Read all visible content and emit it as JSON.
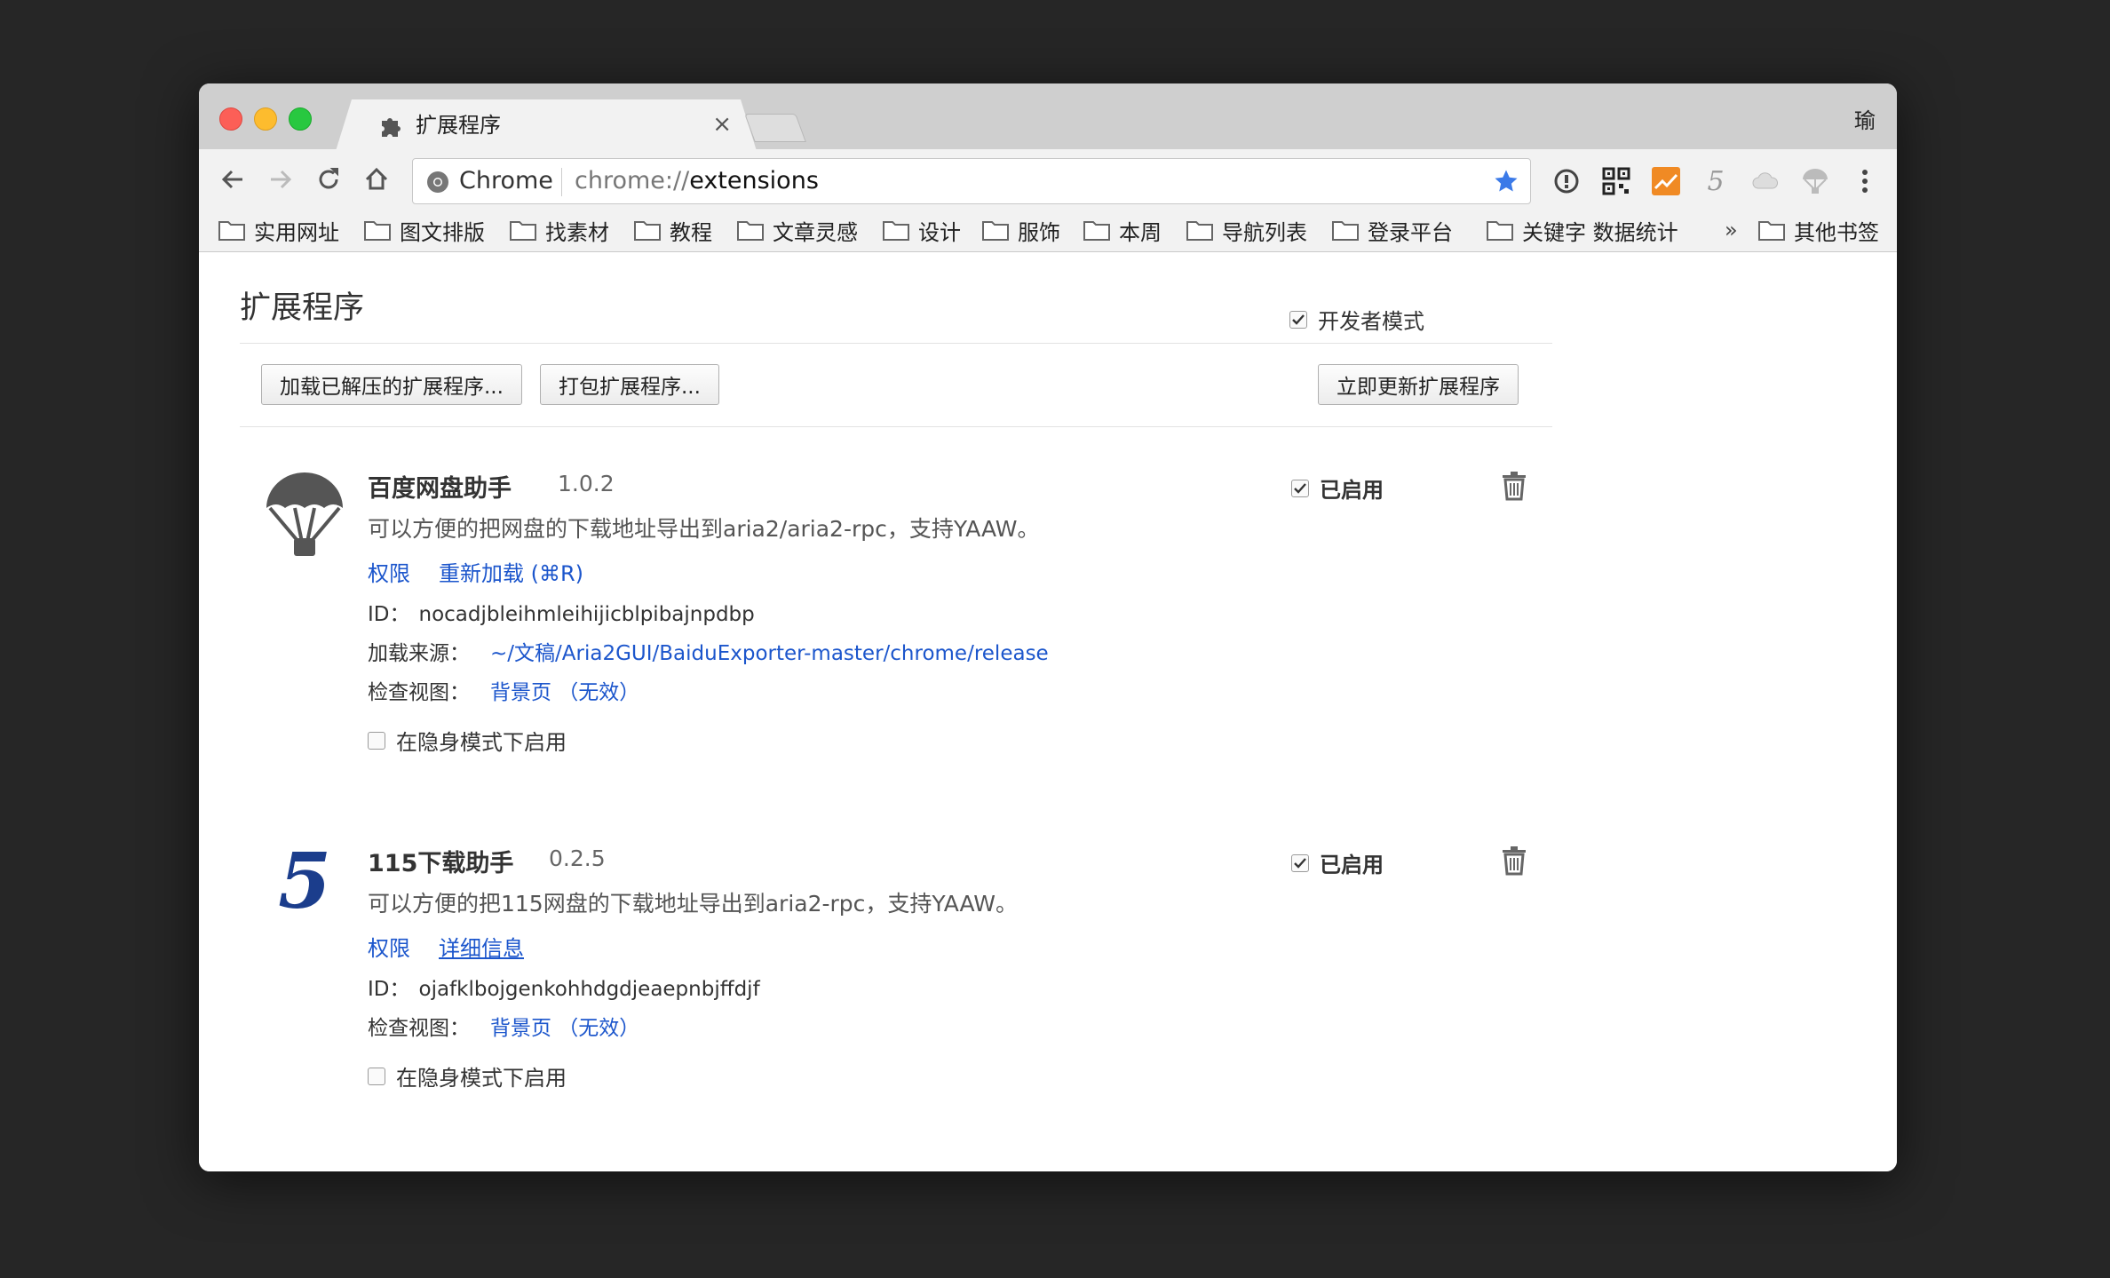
{
  "window": {
    "tab_title": "扩展程序",
    "tab_close": "×",
    "profile_name": "瑜"
  },
  "omnibox": {
    "chip": "Chrome",
    "scheme": "chrome://",
    "host": "extensions"
  },
  "bookmarks": [
    {
      "label": "实用网址"
    },
    {
      "label": "图文排版"
    },
    {
      "label": "找素材"
    },
    {
      "label": "教程"
    },
    {
      "label": "文章灵感"
    },
    {
      "label": "设计"
    },
    {
      "label": "服饰"
    },
    {
      "label": "本周"
    },
    {
      "label": "导航列表"
    },
    {
      "label": "登录平台"
    },
    {
      "label": "关键字 数据统计"
    }
  ],
  "bookmarks_more": "»",
  "bookmarks_other": "其他书签",
  "page": {
    "title": "扩展程序",
    "dev_mode_label": "开发者模式",
    "dev_mode_checked": true,
    "buttons": {
      "load_unpacked": "加载已解压的扩展程序...",
      "pack": "打包扩展程序...",
      "update": "立即更新扩展程序"
    }
  },
  "extensions": [
    {
      "name": "百度网盘助手",
      "version": "1.0.2",
      "description": "可以方便的把网盘的下载地址导出到aria2/aria2-rpc，支持YAAW。",
      "link_permissions": "权限",
      "link_reload": "重新加载 (⌘R)",
      "id_label": "ID：",
      "id_value": "nocadjbleihmleihijicblpibajnpdbp",
      "source_label": "加载来源：",
      "source_value": "~/文稿/Aria2GUI/BaiduExporter-master/chrome/release",
      "views_label": "检查视图：",
      "views_value": "背景页 （无效）",
      "incognito_label": "在隐身模式下启用",
      "enabled_label": "已启用"
    },
    {
      "name": "115下载助手",
      "version": "0.2.5",
      "logo_text": "5",
      "description": "可以方便的把115网盘的下载地址导出到aria2-rpc，支持YAAW。",
      "link_permissions": "权限",
      "link_details": "详细信息",
      "id_label": "ID：",
      "id_value": "ojafklbojgenkohhdgdjeaepnbjffdjf",
      "views_label": "检查视图：",
      "views_value": "背景页 （无效）",
      "incognito_label": "在隐身模式下启用",
      "enabled_label": "已启用"
    }
  ],
  "toolbar_ext_icons": [
    {
      "icon": "info-circle-icon"
    },
    {
      "icon": "qr-code-icon"
    },
    {
      "icon": "chart-orange-icon",
      "color": "#f08a24"
    },
    {
      "icon": "five-icon",
      "text": "5"
    },
    {
      "icon": "cloud-icon"
    },
    {
      "icon": "parachute-icon"
    }
  ],
  "colors": {
    "link": "#1c56cc",
    "star": "#3b7ae8",
    "chrome_bg": "#f2f2f2"
  }
}
